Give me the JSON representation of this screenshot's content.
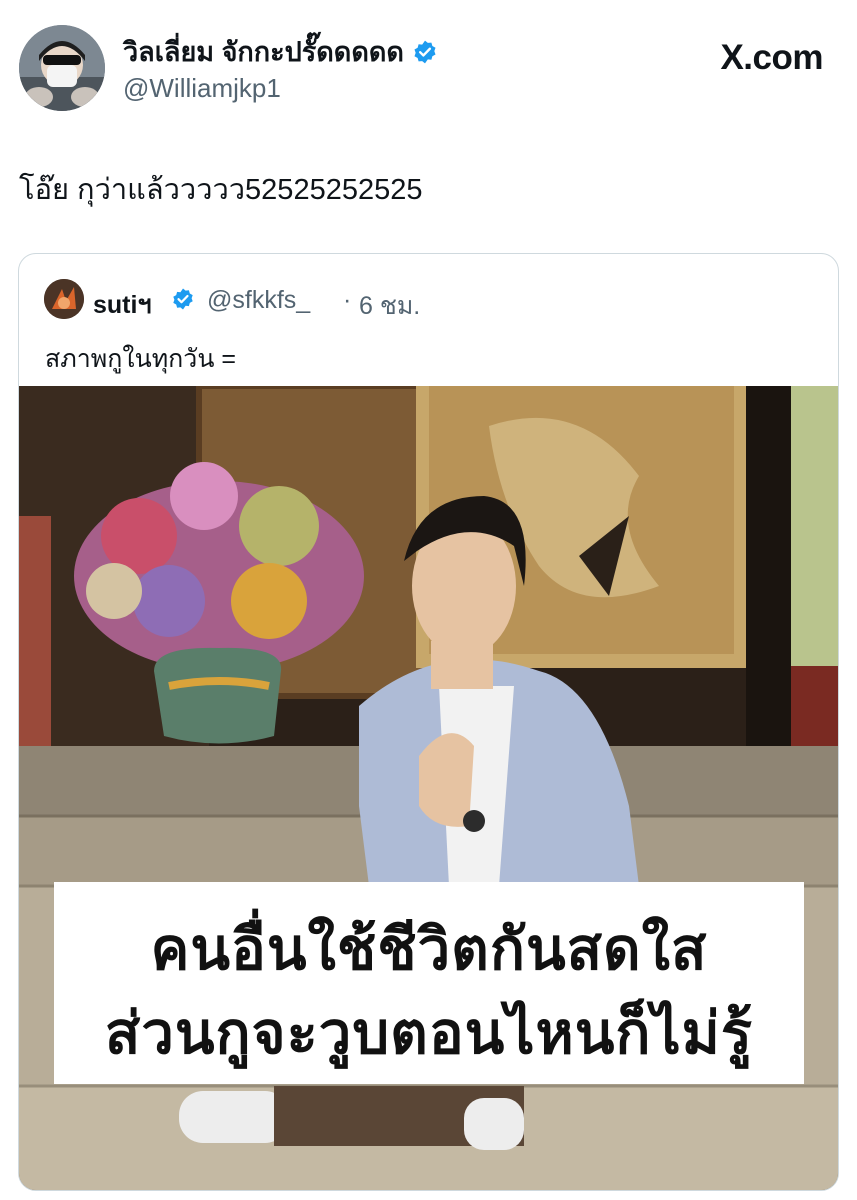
{
  "brand": "X.com",
  "author": {
    "display_name": "วิลเลี่ยม จักกะปรั๊ดดดดด",
    "handle": "@Williamjkp1",
    "verified_color": "#1d9bf0"
  },
  "tweet": {
    "text": "โอ๊ย กุว่าแล้ววววว52525252525"
  },
  "quoted": {
    "display_name": "sutiฯ",
    "handle": "@sfkkfs_",
    "separator": "·",
    "time": "6 ชม.",
    "text": "สภาพกูในทุกวัน =",
    "image_caption": {
      "line1": "คนอื่นใช้ชีวิตกันสดใส",
      "line2": "ส่วนกูจะวูบตอนไหนก็ไม่รู้"
    }
  },
  "icons": {
    "author_verified": "verified-badge-icon",
    "quoted_verified": "verified-badge-icon"
  }
}
